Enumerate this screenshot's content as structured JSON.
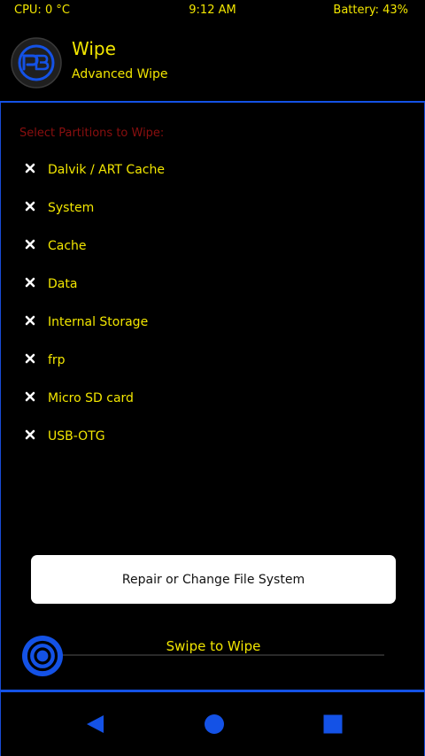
{
  "status": {
    "cpu": "CPU: 0 °C",
    "time": "9:12 AM",
    "battery": "Battery: 43%"
  },
  "header": {
    "title": "Wipe",
    "subtitle": "Advanced Wipe",
    "logo_icon": "pb-logo-icon"
  },
  "section_label": "Select Partitions to Wipe:",
  "partitions": [
    {
      "label": "Dalvik / ART Cache",
      "checked": false
    },
    {
      "label": "System",
      "checked": false
    },
    {
      "label": "Cache",
      "checked": false
    },
    {
      "label": "Data",
      "checked": false
    },
    {
      "label": "Internal Storage",
      "checked": false
    },
    {
      "label": "frp",
      "checked": false
    },
    {
      "label": "Micro SD card",
      "checked": false
    },
    {
      "label": "USB-OTG",
      "checked": false
    }
  ],
  "repair_button_label": "Repair or Change File System",
  "swipe_label": "Swipe to Wipe",
  "nav": {
    "back_icon": "triangle-back-icon",
    "home_icon": "circle-home-icon",
    "recent_icon": "square-recent-icon"
  },
  "colors": {
    "accent": "#1452e6",
    "text": "#f2e600",
    "section_label": "#8a0f0f",
    "background": "#000000"
  }
}
